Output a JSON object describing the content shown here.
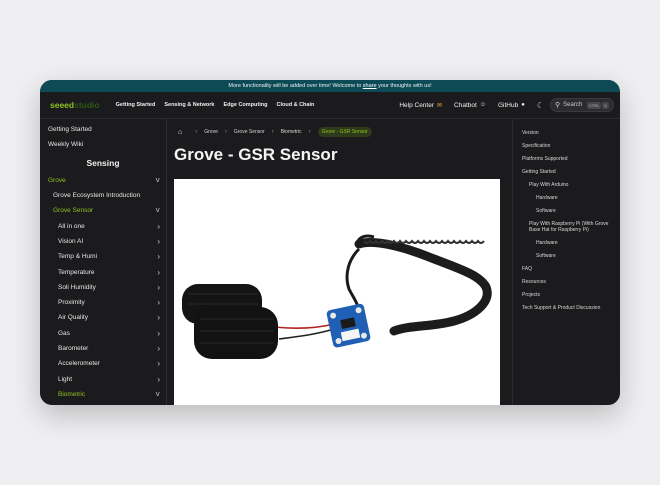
{
  "banner": {
    "prefix": "More functionality will be added over time! Welcome to ",
    "link": "share",
    "suffix": " your thoughts with us!"
  },
  "logo": {
    "part1": "seeed",
    "part2": "studio"
  },
  "nav": {
    "items": [
      "Getting Started",
      "Sensing & Network",
      "Edge Computing",
      "Cloud & Chain"
    ],
    "right": [
      {
        "label": "Help Center",
        "icon": "chat-bubble-icon"
      },
      {
        "label": "Chatbot",
        "icon": "robot-icon"
      },
      {
        "label": "GitHub",
        "icon": "github-icon"
      }
    ],
    "search_label": "Search",
    "search_keys": [
      "CTRL",
      "K"
    ]
  },
  "sidebar": {
    "top_items": [
      "Getting Started",
      "Weekly Wiki"
    ],
    "section_title": "Sensing",
    "items": [
      {
        "label": "Grove",
        "level": 0,
        "chevron": "down",
        "green": true
      },
      {
        "label": "Grove Ecosystem Introduction",
        "level": 1,
        "chevron": "",
        "green": false
      },
      {
        "label": "Grove Sensor",
        "level": 1,
        "chevron": "down",
        "green": true
      },
      {
        "label": "All in one",
        "level": 2,
        "chevron": "right",
        "green": false
      },
      {
        "label": "Vision AI",
        "level": 2,
        "chevron": "right",
        "green": false
      },
      {
        "label": "Temp & Humi",
        "level": 2,
        "chevron": "right",
        "green": false
      },
      {
        "label": "Temperature",
        "level": 2,
        "chevron": "right",
        "green": false
      },
      {
        "label": "Soli Humidity",
        "level": 2,
        "chevron": "right",
        "green": false
      },
      {
        "label": "Proximity",
        "level": 2,
        "chevron": "right",
        "green": false
      },
      {
        "label": "Air Quality",
        "level": 2,
        "chevron": "right",
        "green": false
      },
      {
        "label": "Gas",
        "level": 2,
        "chevron": "right",
        "green": false
      },
      {
        "label": "Barometer",
        "level": 2,
        "chevron": "right",
        "green": false
      },
      {
        "label": "Accelerometer",
        "level": 2,
        "chevron": "right",
        "green": false
      },
      {
        "label": "Light",
        "level": 2,
        "chevron": "right",
        "green": false
      },
      {
        "label": "Biometric",
        "level": 2,
        "chevron": "down",
        "green": true
      }
    ]
  },
  "breadcrumb": [
    "Grove",
    "Grove Sensor",
    "Biometric",
    "Grove - GSR Sensor"
  ],
  "page_title": "Grove - GSR Sensor",
  "toc": [
    {
      "label": "Version",
      "level": 0
    },
    {
      "label": "Specification",
      "level": 0
    },
    {
      "label": "Platforms Supported",
      "level": 0
    },
    {
      "label": "Getting Started",
      "level": 0
    },
    {
      "label": "Play With Arduino",
      "level": 1
    },
    {
      "label": "Hardware",
      "level": 2
    },
    {
      "label": "Software",
      "level": 2
    },
    {
      "label": "Play With Raspberry Pi (With Grove Base Hat for Raspberry Pi)",
      "level": 1
    },
    {
      "label": "Hardware",
      "level": 2
    },
    {
      "label": "Software",
      "level": 2
    },
    {
      "label": "FAQ",
      "level": 0
    },
    {
      "label": "Resources",
      "level": 0
    },
    {
      "label": "Projects",
      "level": 0
    },
    {
      "label": "Tech Support & Product Discussion",
      "level": 0
    }
  ],
  "colors": {
    "accent": "#8fc31f",
    "banner": "#0e4a55",
    "background": "#1b1b1d"
  }
}
